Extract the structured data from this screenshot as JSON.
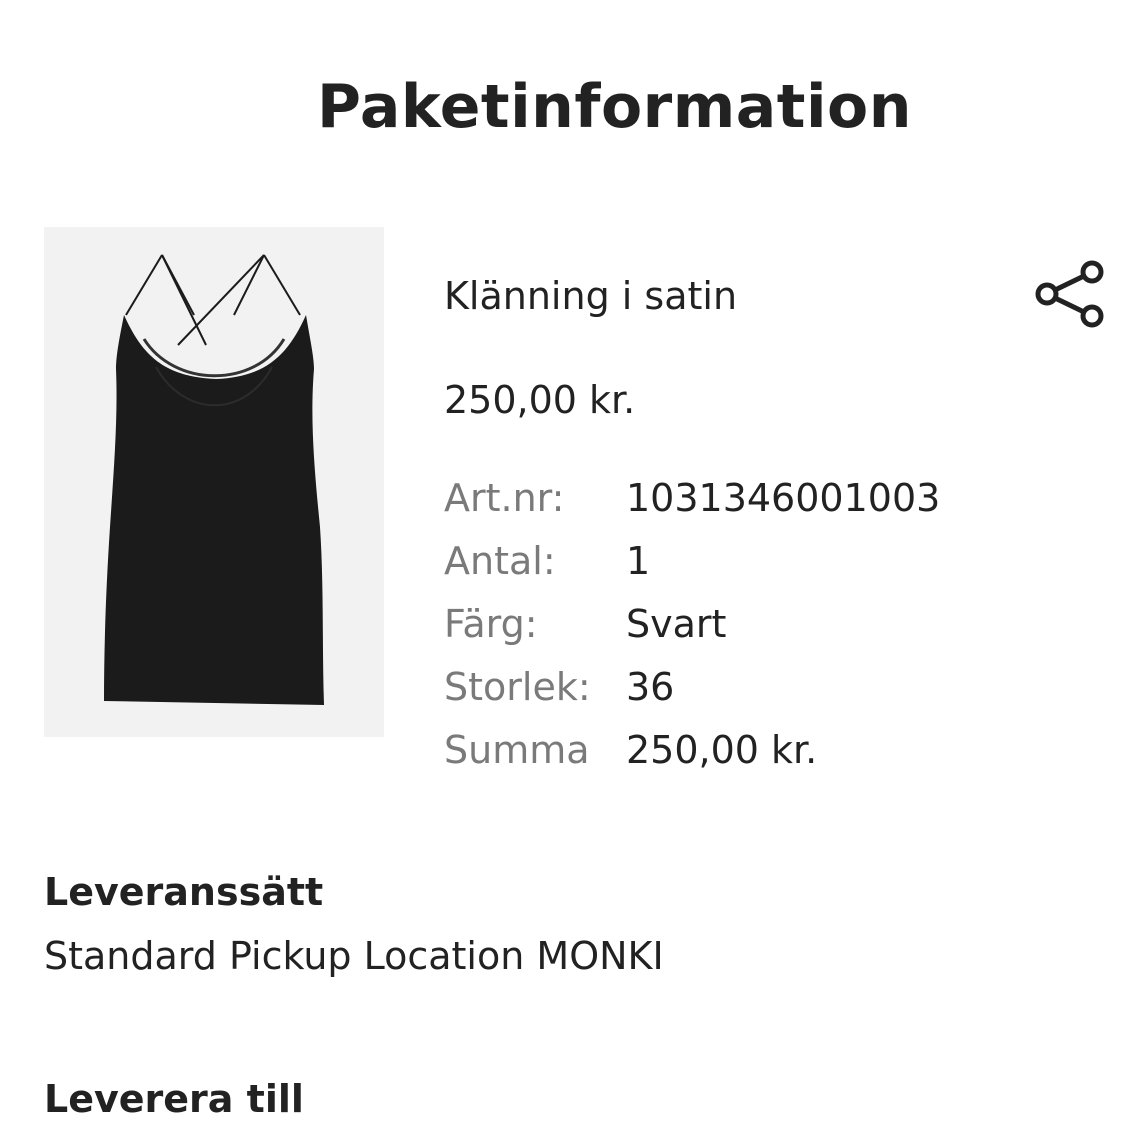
{
  "page": {
    "title": "Paketinformation"
  },
  "product": {
    "image_icon": "satin-dress-image",
    "name": "Klänning i satin",
    "price": "250,00 kr.",
    "share_icon": "share-icon",
    "details": [
      {
        "label": "Art.nr:",
        "value": "1031346001003"
      },
      {
        "label": "Antal:",
        "value": "1"
      },
      {
        "label": "Färg:",
        "value": "Svart"
      },
      {
        "label": "Storlek:",
        "value": "36"
      },
      {
        "label": "Summa",
        "value": "250,00 kr."
      }
    ]
  },
  "delivery": {
    "method_heading": "Leveranssätt",
    "method_value": "Standard Pickup Location MONKI",
    "ship_to_heading": "Leverera till"
  },
  "colors": {
    "text": "#222222",
    "label": "#7a7a7a",
    "image_background": "#f2f2f2",
    "dress": "#1b1b1b"
  }
}
